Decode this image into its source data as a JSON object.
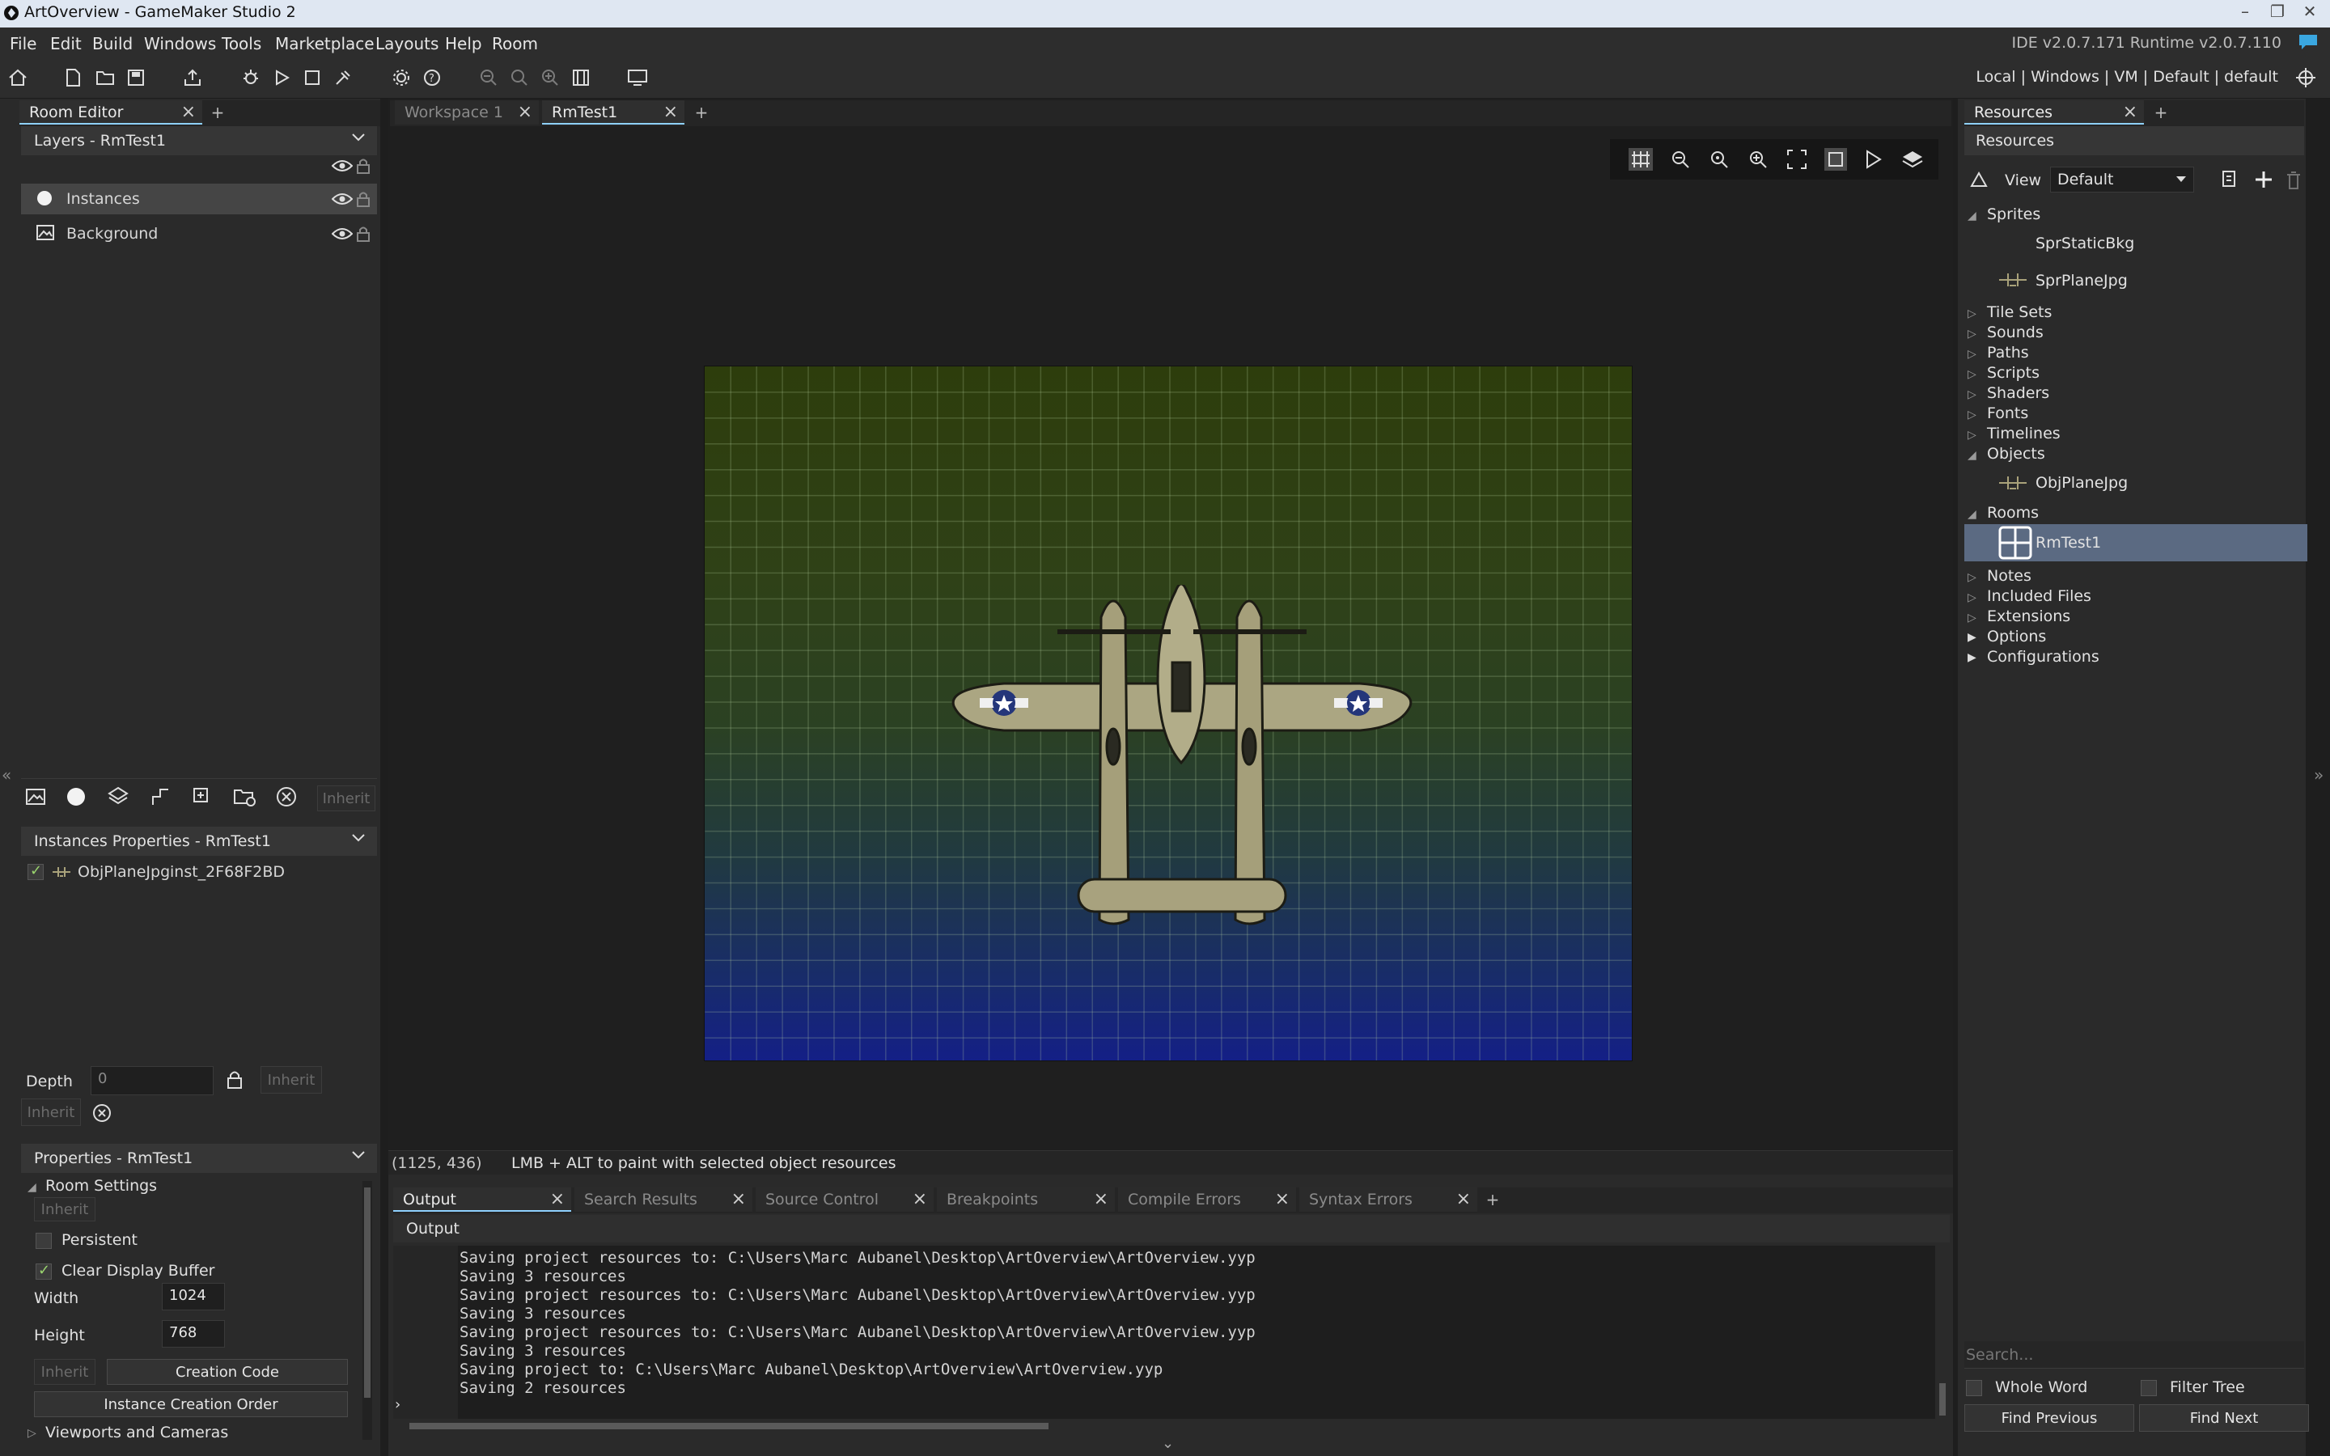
{
  "window": {
    "title": "ArtOverview - GameMaker Studio 2"
  },
  "menu": [
    "File",
    "Edit",
    "Build",
    "Windows",
    "Tools",
    "Marketplace",
    "Layouts",
    "Help",
    "Room"
  ],
  "ide_version": "IDE v2.0.7.171 Runtime v2.0.7.110",
  "target_info": "Local | Windows | VM | Default | default",
  "left_dock": {
    "tab_label": "Room Editor",
    "layers_header": "Layers - RmTest1",
    "layers": [
      {
        "label": "Instances",
        "icon": "instance-layer-icon",
        "selected": true
      },
      {
        "label": "Background",
        "icon": "background-layer-icon",
        "selected": false
      }
    ],
    "layer_inherit": "Inherit",
    "instances_header": "Instances Properties - RmTest1",
    "instances": [
      {
        "object": "ObjPlaneJpg",
        "name": "inst_2F68F2BD",
        "checked": true
      }
    ],
    "depth_label": "Depth",
    "depth_value": "0",
    "depth_inherit": "Inherit",
    "inherit_btn": "Inherit",
    "properties_header": "Properties - RmTest1",
    "room_settings": "Room Settings",
    "room_inherit": "Inherit",
    "persistent": {
      "label": "Persistent",
      "checked": false
    },
    "clear_display": {
      "label": "Clear Display Buffer",
      "checked": true
    },
    "width_label": "Width",
    "width_value": "1024",
    "height_label": "Height",
    "height_value": "768",
    "creation_code": "Creation Code",
    "instance_order": "Instance Creation Order",
    "viewports": "Viewports and Cameras"
  },
  "workspace": {
    "tabs": [
      {
        "label": "Workspace 1",
        "active": false
      },
      {
        "label": "RmTest1",
        "active": true
      }
    ],
    "status_coords": "(1125, 436)",
    "status_hint": "LMB + ALT to paint with selected object resources"
  },
  "output": {
    "tabs": [
      "Output",
      "Search Results",
      "Source Control",
      "Breakpoints",
      "Compile Errors",
      "Syntax Errors"
    ],
    "header": "Output",
    "lines": [
      "Saving project resources to: C:\\Users\\Marc Aubanel\\Desktop\\ArtOverview\\ArtOverview.yyp",
      "Saving 3 resources",
      "Saving project resources to: C:\\Users\\Marc Aubanel\\Desktop\\ArtOverview\\ArtOverview.yyp",
      "Saving 3 resources",
      "Saving project resources to: C:\\Users\\Marc Aubanel\\Desktop\\ArtOverview\\ArtOverview.yyp",
      "Saving 3 resources",
      "Saving project to: C:\\Users\\Marc Aubanel\\Desktop\\ArtOverview\\ArtOverview.yyp",
      "Saving 2 resources"
    ]
  },
  "resources": {
    "tab_label": "Resources",
    "header": "Resources",
    "view_label": "View",
    "view_value": "Default",
    "tree": [
      {
        "label": "Sprites",
        "expanded": true,
        "children": [
          "SprStaticBkg",
          "SprPlaneJpg"
        ]
      },
      {
        "label": "Tile Sets"
      },
      {
        "label": "Sounds"
      },
      {
        "label": "Paths"
      },
      {
        "label": "Scripts"
      },
      {
        "label": "Shaders"
      },
      {
        "label": "Fonts"
      },
      {
        "label": "Timelines"
      },
      {
        "label": "Objects",
        "expanded": true,
        "children": [
          "ObjPlaneJpg"
        ]
      },
      {
        "label": "Rooms",
        "expanded": true,
        "children": [
          "RmTest1"
        ]
      },
      {
        "label": "Notes"
      },
      {
        "label": "Included Files"
      },
      {
        "label": "Extensions"
      },
      {
        "label": "Options"
      },
      {
        "label": "Configurations"
      }
    ],
    "search_placeholder": "Search...",
    "whole_word": "Whole Word",
    "filter_tree": "Filter Tree",
    "find_previous": "Find Previous",
    "find_next": "Find Next"
  },
  "colors": {
    "accent": "#8fd1ff",
    "room_top": "#2d3d0c",
    "room_bottom": "#141f86"
  }
}
